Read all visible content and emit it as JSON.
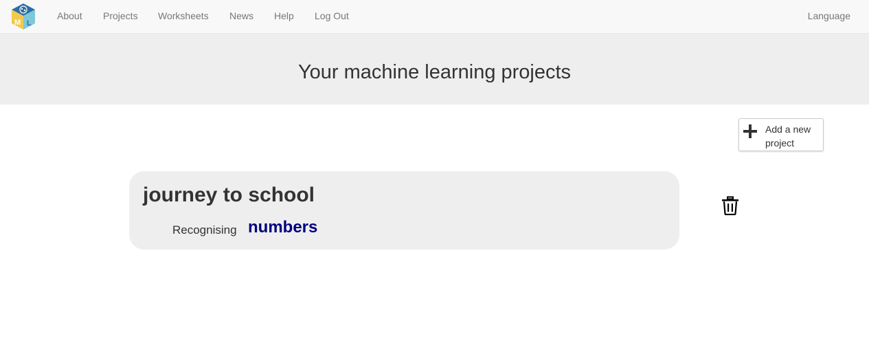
{
  "nav": {
    "logo_letters": [
      "M",
      "L"
    ],
    "about": "About",
    "projects": "Projects",
    "worksheets": "Worksheets",
    "news": "News",
    "help": "Help",
    "logout": "Log Out",
    "language": "Language"
  },
  "header": {
    "title": "Your machine learning projects"
  },
  "toolbar": {
    "add_icon": "plus-icon",
    "add_label": "Add a new project"
  },
  "projects": [
    {
      "name": "journey to school",
      "recognising_label": "Recognising",
      "type": "numbers",
      "delete_icon": "trash-icon"
    }
  ],
  "colors": {
    "navbar_bg": "#f8f8f8",
    "jumbotron_bg": "#eeeeee",
    "card_bg": "#eeeeee",
    "project_type": "#000080",
    "nav_link": "#777777"
  }
}
